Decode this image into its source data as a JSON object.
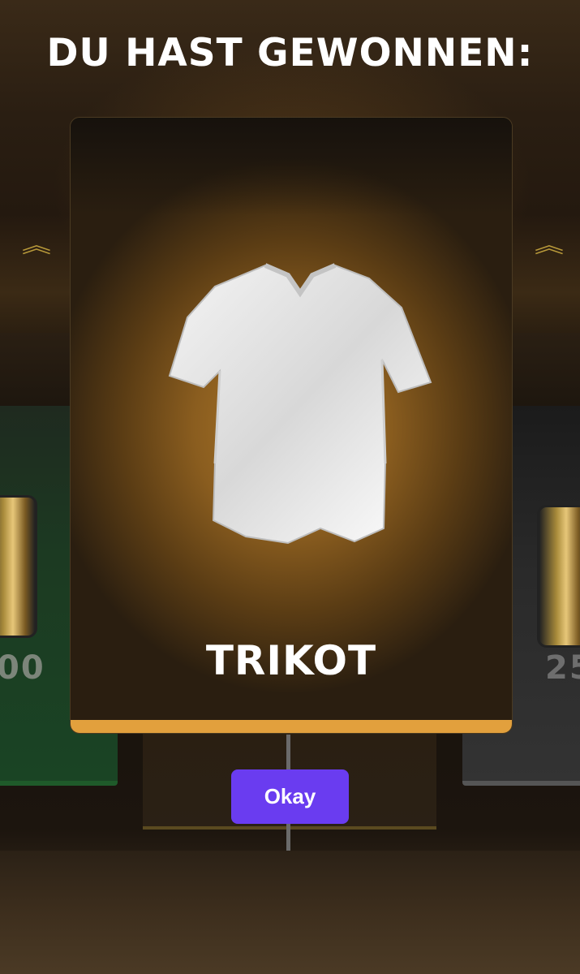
{
  "screen": {
    "title": "DU HAST GEWONNEN:"
  },
  "reward_card": {
    "item_name": "TRIKOT",
    "item_icon": "shirt-icon",
    "accent_color": "#e2a03d"
  },
  "side_cards": {
    "left_amount": "00",
    "right_amount": "25",
    "chevron_icon": "double-chevron-up-icon"
  },
  "actions": {
    "okay_label": "Okay",
    "okay_color": "#6a3cf0"
  }
}
